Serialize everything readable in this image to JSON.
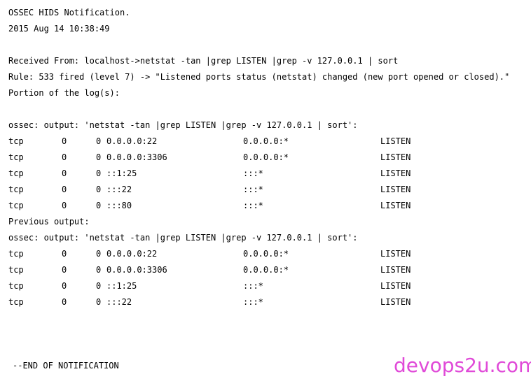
{
  "header": {
    "title": "OSSEC HIDS Notification.",
    "timestamp": "2015 Aug 14 10:38:49"
  },
  "alert": {
    "received_from": "Received From: localhost->netstat -tan |grep LISTEN |grep -v 127.0.0.1 | sort",
    "rule": "Rule: 533 fired (level 7) -> \"Listened ports status (netstat) changed (new port opened or closed).\"",
    "portion": "Portion of the log(s):"
  },
  "current": {
    "header": "ossec: output: 'netstat -tan |grep LISTEN |grep -v 127.0.0.1 | sort':",
    "rows": [
      {
        "proto": "tcp",
        "recv": "0",
        "send": "0",
        "local": "0.0.0.0:22",
        "foreign": "0.0.0.0:*",
        "state": "LISTEN"
      },
      {
        "proto": "tcp",
        "recv": "0",
        "send": "0",
        "local": "0.0.0.0:3306",
        "foreign": "0.0.0.0:*",
        "state": "LISTEN"
      },
      {
        "proto": "tcp",
        "recv": "0",
        "send": "0",
        "local": "::1:25",
        "foreign": ":::*",
        "state": "LISTEN"
      },
      {
        "proto": "tcp",
        "recv": "0",
        "send": "0",
        "local": ":::22",
        "foreign": ":::*",
        "state": "LISTEN"
      },
      {
        "proto": "tcp",
        "recv": "0",
        "send": "0",
        "local": ":::80",
        "foreign": ":::*",
        "state": "LISTEN"
      }
    ]
  },
  "previous": {
    "label": "Previous output:",
    "header": "ossec: output: 'netstat -tan |grep LISTEN |grep -v 127.0.0.1 | sort':",
    "rows": [
      {
        "proto": "tcp",
        "recv": "0",
        "send": "0",
        "local": "0.0.0.0:22",
        "foreign": "0.0.0.0:*",
        "state": "LISTEN"
      },
      {
        "proto": "tcp",
        "recv": "0",
        "send": "0",
        "local": "0.0.0.0:3306",
        "foreign": "0.0.0.0:*",
        "state": "LISTEN"
      },
      {
        "proto": "tcp",
        "recv": "0",
        "send": "0",
        "local": "::1:25",
        "foreign": ":::*",
        "state": "LISTEN"
      },
      {
        "proto": "tcp",
        "recv": "0",
        "send": "0",
        "local": ":::22",
        "foreign": ":::*",
        "state": "LISTEN"
      }
    ]
  },
  "footer": {
    "end": "--END OF NOTIFICATION",
    "watermark": "devops2u.com",
    "watermark_color": "#e04ad8"
  }
}
